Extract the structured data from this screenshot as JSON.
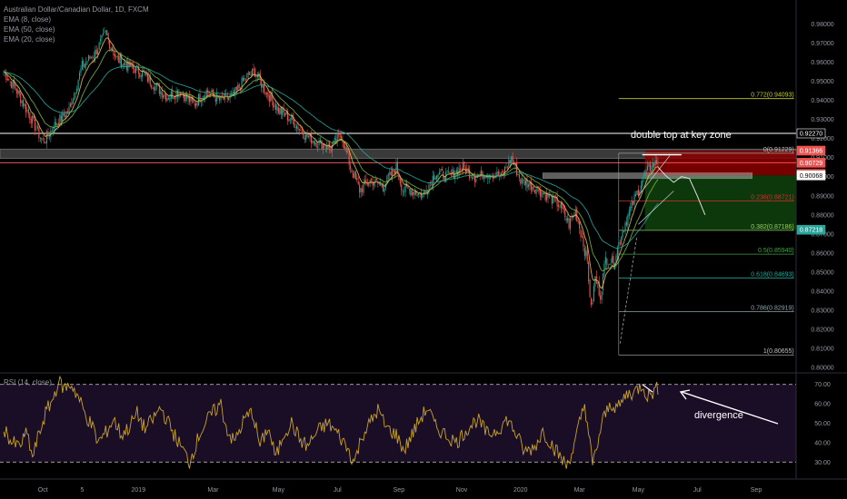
{
  "header": {
    "title": "Australian Dollar/Canadian Dollar, 1D, FXCM",
    "indicators": [
      "EMA (8, close)",
      "EMA (50, close)",
      "EMA (20, close)"
    ],
    "rsi_label": "RSI (14, close)"
  },
  "annotations": {
    "double_top": "double top at key zone",
    "divergence": "divergence"
  },
  "colors": {
    "up_candle": "#26a69a",
    "down_candle": "#ef5350",
    "ema_fast": "#e8c14a",
    "ema_slow": "#26a69a",
    "fib": "#9ccc65",
    "resistance": "#ffffff",
    "loss_zone": "#8b0000",
    "profit_zone": "#0d3b0d",
    "rsi_line": "#c9a227",
    "rsi_bg": "#1a0d26"
  },
  "price_axis": {
    "ticks": [
      "0.98000",
      "0.97000",
      "0.96000",
      "0.95000",
      "0.94000",
      "0.93000",
      "0.92000",
      "0.91000",
      "0.90000",
      "0.89000",
      "0.88000",
      "0.87000",
      "0.86000",
      "0.85000",
      "0.84000",
      "0.83000",
      "0.82000",
      "0.81000",
      "0.80000"
    ],
    "range": [
      0.8,
      0.985
    ]
  },
  "price_tags": [
    {
      "label": "0.92270",
      "value": 0.9227,
      "bg": "#000000",
      "fg": "#ffffff",
      "border": "#ffffff"
    },
    {
      "label": "0.91366",
      "value": 0.91366,
      "bg": "#ef5350",
      "fg": "#ffffff",
      "border": "#ef5350"
    },
    {
      "label": "0.90729",
      "value": 0.90729,
      "bg": "#ef5350",
      "fg": "#ffffff",
      "border": "#ef5350"
    },
    {
      "label": "09:32:19",
      "value": 0.9015,
      "bg": "#ef5350",
      "fg": "#ffffff",
      "border": "#ef5350"
    },
    {
      "label": "0.90068",
      "value": 0.90068,
      "bg": "#ffffff",
      "fg": "#000000",
      "border": "#ffffff"
    },
    {
      "label": "0.87218",
      "value": 0.87218,
      "bg": "#26a69a",
      "fg": "#ffffff",
      "border": "#26a69a"
    }
  ],
  "time_axis": {
    "labels": [
      "Oct",
      "5",
      "2019",
      "Mar",
      "May",
      "Jul",
      "Sep",
      "Nov",
      "2020",
      "Mar",
      "May",
      "Jul",
      "Sep"
    ],
    "bar_index": [
      30,
      60,
      103,
      160,
      210,
      255,
      302,
      350,
      395,
      440,
      485,
      530,
      575
    ]
  },
  "rsi_axis": {
    "ticks": [
      "70.00",
      "60.00",
      "50.00",
      "40.00",
      "30.00"
    ],
    "range": [
      25,
      75
    ],
    "levels": [
      70,
      30
    ]
  },
  "chart_data": {
    "type": "candlestick",
    "symbol": "Australian Dollar/Canadian Dollar",
    "interval": "1D",
    "anchors": [
      [
        0,
        0.955
      ],
      [
        10,
        0.945
      ],
      [
        20,
        0.932
      ],
      [
        30,
        0.918
      ],
      [
        40,
        0.928
      ],
      [
        50,
        0.935
      ],
      [
        60,
        0.958
      ],
      [
        70,
        0.965
      ],
      [
        78,
        0.975
      ],
      [
        86,
        0.962
      ],
      [
        95,
        0.958
      ],
      [
        105,
        0.955
      ],
      [
        115,
        0.948
      ],
      [
        125,
        0.942
      ],
      [
        135,
        0.945
      ],
      [
        145,
        0.938
      ],
      [
        155,
        0.945
      ],
      [
        165,
        0.94
      ],
      [
        175,
        0.942
      ],
      [
        185,
        0.952
      ],
      [
        192,
        0.955
      ],
      [
        200,
        0.945
      ],
      [
        210,
        0.935
      ],
      [
        220,
        0.93
      ],
      [
        230,
        0.922
      ],
      [
        240,
        0.918
      ],
      [
        250,
        0.915
      ],
      [
        258,
        0.922
      ],
      [
        265,
        0.905
      ],
      [
        272,
        0.893
      ],
      [
        280,
        0.898
      ],
      [
        290,
        0.895
      ],
      [
        300,
        0.905
      ],
      [
        305,
        0.893
      ],
      [
        312,
        0.893
      ],
      [
        320,
        0.89
      ],
      [
        330,
        0.902
      ],
      [
        340,
        0.9
      ],
      [
        350,
        0.905
      ],
      [
        360,
        0.9
      ],
      [
        370,
        0.902
      ],
      [
        380,
        0.9
      ],
      [
        388,
        0.91
      ],
      [
        395,
        0.898
      ],
      [
        405,
        0.895
      ],
      [
        415,
        0.89
      ],
      [
        425,
        0.885
      ],
      [
        432,
        0.875
      ],
      [
        437,
        0.882
      ],
      [
        442,
        0.868
      ],
      [
        446,
        0.855
      ],
      [
        449,
        0.83
      ],
      [
        452,
        0.847
      ],
      [
        456,
        0.838
      ],
      [
        460,
        0.857
      ],
      [
        466,
        0.855
      ],
      [
        472,
        0.87
      ],
      [
        480,
        0.885
      ],
      [
        488,
        0.898
      ],
      [
        494,
        0.905
      ],
      [
        500,
        0.908
      ]
    ],
    "fib_levels": [
      {
        "ratio": "0",
        "price": 0.91229,
        "label": "0(0.91229)"
      },
      {
        "ratio": "0.236",
        "price": 0.88721,
        "label": "0.236(0.88721)"
      },
      {
        "ratio": "0.382",
        "price": 0.87186,
        "label": "0.382(0.87186)"
      },
      {
        "ratio": "0.5",
        "price": 0.8594,
        "label": "0.5(0.85940)"
      },
      {
        "ratio": "0.618",
        "price": 0.84693,
        "label": "0.618(0.84693)"
      },
      {
        "ratio": "0.786",
        "price": 0.82919,
        "label": "0.786(0.82919)"
      },
      {
        "ratio": "1",
        "price": 0.80655,
        "label": "1(0.80655)"
      }
    ],
    "extra_level": {
      "price": 0.94093,
      "label": "0.772(0.94093)"
    },
    "key_zone": {
      "top": 0.9145,
      "bottom": 0.9095
    },
    "resistance_line": 0.9227,
    "red_line": 0.9073,
    "trade": {
      "entry": 0.90068,
      "stop": 0.91366,
      "target": 0.87218
    },
    "rsi_anchors": [
      [
        0,
        48
      ],
      [
        6,
        40
      ],
      [
        12,
        38
      ],
      [
        18,
        45
      ],
      [
        22,
        32
      ],
      [
        26,
        42
      ],
      [
        32,
        55
      ],
      [
        38,
        63
      ],
      [
        42,
        72
      ],
      [
        46,
        68
      ],
      [
        52,
        70
      ],
      [
        58,
        62
      ],
      [
        62,
        55
      ],
      [
        68,
        48
      ],
      [
        72,
        40
      ],
      [
        78,
        45
      ],
      [
        84,
        52
      ],
      [
        90,
        44
      ],
      [
        96,
        48
      ],
      [
        102,
        55
      ],
      [
        108,
        47
      ],
      [
        114,
        52
      ],
      [
        120,
        58
      ],
      [
        126,
        50
      ],
      [
        132,
        42
      ],
      [
        138,
        35
      ],
      [
        142,
        30
      ],
      [
        150,
        45
      ],
      [
        158,
        54
      ],
      [
        166,
        60
      ],
      [
        170,
        48
      ],
      [
        176,
        40
      ],
      [
        184,
        52
      ],
      [
        190,
        56
      ],
      [
        196,
        38
      ],
      [
        202,
        48
      ],
      [
        208,
        32
      ],
      [
        214,
        45
      ],
      [
        220,
        50
      ],
      [
        226,
        42
      ],
      [
        232,
        38
      ],
      [
        240,
        46
      ],
      [
        248,
        50
      ],
      [
        256,
        44
      ],
      [
        262,
        38
      ],
      [
        268,
        30
      ],
      [
        274,
        44
      ],
      [
        280,
        50
      ],
      [
        286,
        57
      ],
      [
        292,
        48
      ],
      [
        300,
        44
      ],
      [
        306,
        36
      ],
      [
        312,
        44
      ],
      [
        318,
        52
      ],
      [
        324,
        58
      ],
      [
        330,
        48
      ],
      [
        338,
        44
      ],
      [
        346,
        40
      ],
      [
        354,
        47
      ],
      [
        362,
        52
      ],
      [
        370,
        44
      ],
      [
        378,
        47
      ],
      [
        385,
        52
      ],
      [
        392,
        44
      ],
      [
        398,
        35
      ],
      [
        406,
        38
      ],
      [
        412,
        46
      ],
      [
        418,
        40
      ],
      [
        424,
        34
      ],
      [
        430,
        28
      ],
      [
        436,
        38
      ],
      [
        440,
        50
      ],
      [
        444,
        60
      ],
      [
        447,
        45
      ],
      [
        450,
        28
      ],
      [
        454,
        40
      ],
      [
        458,
        52
      ],
      [
        464,
        60
      ],
      [
        470,
        58
      ],
      [
        476,
        65
      ],
      [
        482,
        66
      ],
      [
        488,
        70
      ],
      [
        492,
        64
      ],
      [
        496,
        66
      ],
      [
        500,
        68
      ]
    ],
    "rsi_divergence_points": [
      [
        488,
        70
      ],
      [
        496,
        66
      ]
    ],
    "price_projection": [
      [
        500,
        0.905
      ],
      [
        506,
        0.9005
      ],
      [
        512,
        0.897
      ],
      [
        518,
        0.9
      ],
      [
        524,
        0.899
      ],
      [
        530,
        0.89
      ],
      [
        536,
        0.88
      ]
    ]
  }
}
